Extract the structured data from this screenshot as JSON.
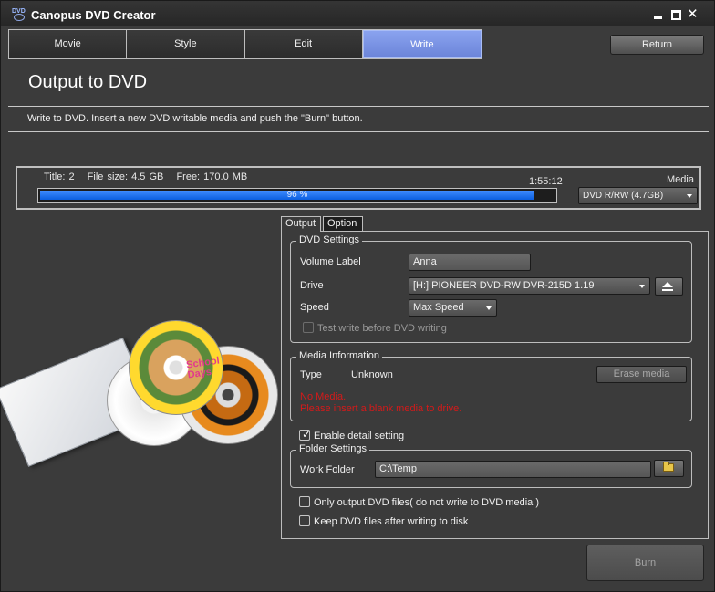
{
  "window": {
    "title": "Canopus DVD Creator",
    "app_icon_text": "DVD"
  },
  "steps": [
    {
      "label": "Movie"
    },
    {
      "label": "Style"
    },
    {
      "label": "Edit"
    },
    {
      "label": "Write",
      "active": true
    }
  ],
  "return_label": "Return",
  "page_title": "Output to DVD",
  "instructions": "Write to DVD. Insert a new DVD writable media and push the \"Burn\" button.",
  "progress": {
    "title": "Title: 2",
    "file_size": "File size: 4.5 GB",
    "free": "Free: 170.0 MB",
    "time": "1:55:12",
    "percent": 96,
    "percent_text": "96 %",
    "media_label": "Media",
    "media_value": "DVD R/RW (4.7GB)"
  },
  "artwork": {
    "disc_text_line1": "School",
    "disc_text_line2": "Days"
  },
  "tabs": [
    {
      "label": "Output",
      "active": true
    },
    {
      "label": "Option"
    }
  ],
  "dvd_settings": {
    "title": "DVD Settings",
    "volume_label_label": "Volume Label",
    "volume_label_value": "Anna",
    "drive_label": "Drive",
    "drive_value": "[H:] PIONEER DVD-RW  DVR-215D 1.19",
    "speed_label": "Speed",
    "speed_value": "Max Speed",
    "test_write_label": "Test write before DVD writing"
  },
  "media_info": {
    "title": "Media Information",
    "type_label": "Type",
    "type_value": "Unknown",
    "erase_label": "Erase media",
    "error_line1": "No Media.",
    "error_line2": "Please insert a blank media to drive."
  },
  "detail_setting_label": "Enable detail setting",
  "folder_settings": {
    "title": "Folder Settings",
    "work_folder_label": "Work Folder",
    "work_folder_value": "C:\\Temp"
  },
  "options": {
    "only_output_label": "Only output DVD files( do not write to DVD media )",
    "keep_files_label": "Keep DVD files after writing to disk"
  },
  "burn_label": "Burn",
  "colors": {
    "accent": "#6b84d9",
    "progress": "#0b5fe0",
    "error": "#d41a1a"
  }
}
